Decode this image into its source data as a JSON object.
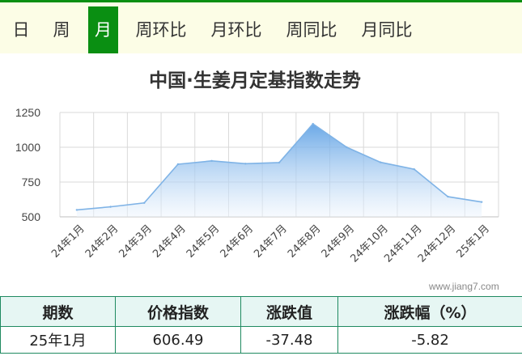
{
  "tabs": [
    {
      "label": "日",
      "active": false
    },
    {
      "label": "周",
      "active": false
    },
    {
      "label": "月",
      "active": true
    },
    {
      "label": "周环比",
      "active": false
    },
    {
      "label": "月环比",
      "active": false
    },
    {
      "label": "周同比",
      "active": false
    },
    {
      "label": "月同比",
      "active": false
    }
  ],
  "watermark": "www.jiang7.com",
  "chart_data": {
    "type": "area",
    "title": "中国·生姜月定基指数走势",
    "categories": [
      "24年1月",
      "24年2月",
      "24年3月",
      "24年4月",
      "24年5月",
      "24年6月",
      "24年7月",
      "24年8月",
      "24年9月",
      "24年10月",
      "24年11月",
      "24年12月",
      "25年1月"
    ],
    "values": [
      550,
      572,
      600,
      878,
      902,
      882,
      890,
      1168,
      1000,
      892,
      842,
      645,
      606.49
    ],
    "yticks": [
      500,
      750,
      1000,
      1250
    ],
    "ylim": [
      500,
      1250
    ],
    "xlabel": "",
    "ylabel": "",
    "grid": true,
    "colors": {
      "line": "#7fb3e6",
      "fill_top": "#5b9fe4",
      "fill_bottom": "#eef5fd",
      "grid": "#d9d9d9"
    }
  },
  "table": {
    "headers": [
      "期数",
      "价格指数",
      "涨跌值",
      "涨跌幅（%）"
    ],
    "row": [
      "25年1月",
      "606.49",
      "-37.48",
      "-5.82"
    ]
  }
}
